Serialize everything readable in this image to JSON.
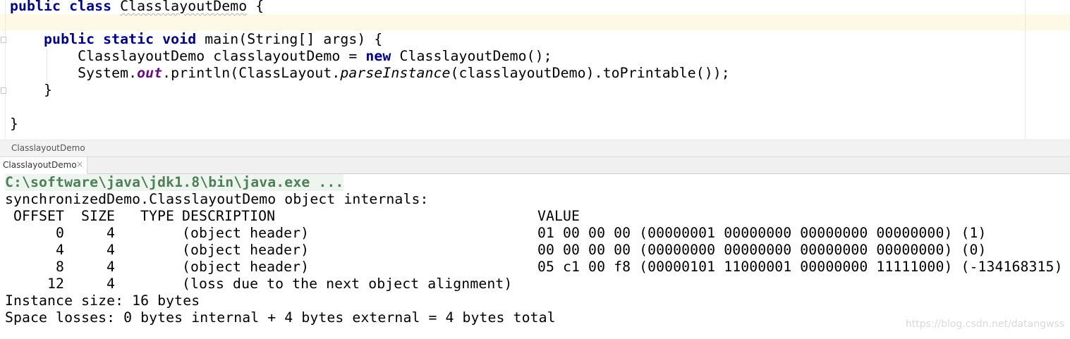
{
  "editor": {
    "lines": [
      {
        "parts": [
          {
            "t": "public class ",
            "c": "kw"
          },
          {
            "t": "ClasslayoutDemo",
            "c": "squiggle"
          },
          {
            "t": " {",
            "c": ""
          }
        ]
      },
      {
        "parts": []
      },
      {
        "parts": [
          {
            "t": "    ",
            "c": ""
          },
          {
            "t": "public static void ",
            "c": "kw"
          },
          {
            "t": "main(String[] args) {",
            "c": ""
          }
        ]
      },
      {
        "parts": [
          {
            "t": "        ClasslayoutDemo classlayoutDemo = ",
            "c": ""
          },
          {
            "t": "new ",
            "c": "kw"
          },
          {
            "t": "ClasslayoutDemo();",
            "c": ""
          }
        ]
      },
      {
        "parts": [
          {
            "t": "        System.",
            "c": ""
          },
          {
            "t": "out",
            "c": "field"
          },
          {
            "t": ".println(ClassLayout.",
            "c": ""
          },
          {
            "t": "parseInstance",
            "c": "ital"
          },
          {
            "t": "(classlayoutDemo).toPrintable());",
            "c": ""
          }
        ]
      },
      {
        "parts": [
          {
            "t": "    }",
            "c": ""
          }
        ]
      },
      {
        "parts": []
      },
      {
        "parts": [
          {
            "t": "}",
            "c": ""
          }
        ]
      }
    ]
  },
  "breadcrumb": {
    "label": "ClasslayoutDemo"
  },
  "run_panel": {
    "tab_label": "ClasslayoutDemo",
    "close_symbol": "×"
  },
  "console": {
    "command": "C:\\software\\java\\jdk1.8\\bin\\java.exe ...",
    "header": "synchronizedDemo.ClasslayoutDemo object internals:",
    "columns": {
      "offset": " OFFSET",
      "size": "SIZE",
      "type": "TYPE",
      "description": "DESCRIPTION",
      "value": "VALUE"
    },
    "rows": [
      {
        "offset": "0",
        "size": "4",
        "description": "(object header)",
        "value": "01 00 00 00 (00000001 00000000 00000000 00000000) (1)"
      },
      {
        "offset": "4",
        "size": "4",
        "description": "(object header)",
        "value": "00 00 00 00 (00000000 00000000 00000000 00000000) (0)"
      },
      {
        "offset": "8",
        "size": "4",
        "description": "(object header)",
        "value": "05 c1 00 f8 (00000101 11000001 00000000 11111000) (-134168315)"
      },
      {
        "offset": "12",
        "size": "4",
        "description": "(loss due to the next object alignment)",
        "value": ""
      }
    ],
    "instance_size": "Instance size: 16 bytes",
    "space_losses": "Space losses: 0 bytes internal + 4 bytes external = 4 bytes total"
  },
  "watermark": "https://blog.csdn.net/datangwss"
}
